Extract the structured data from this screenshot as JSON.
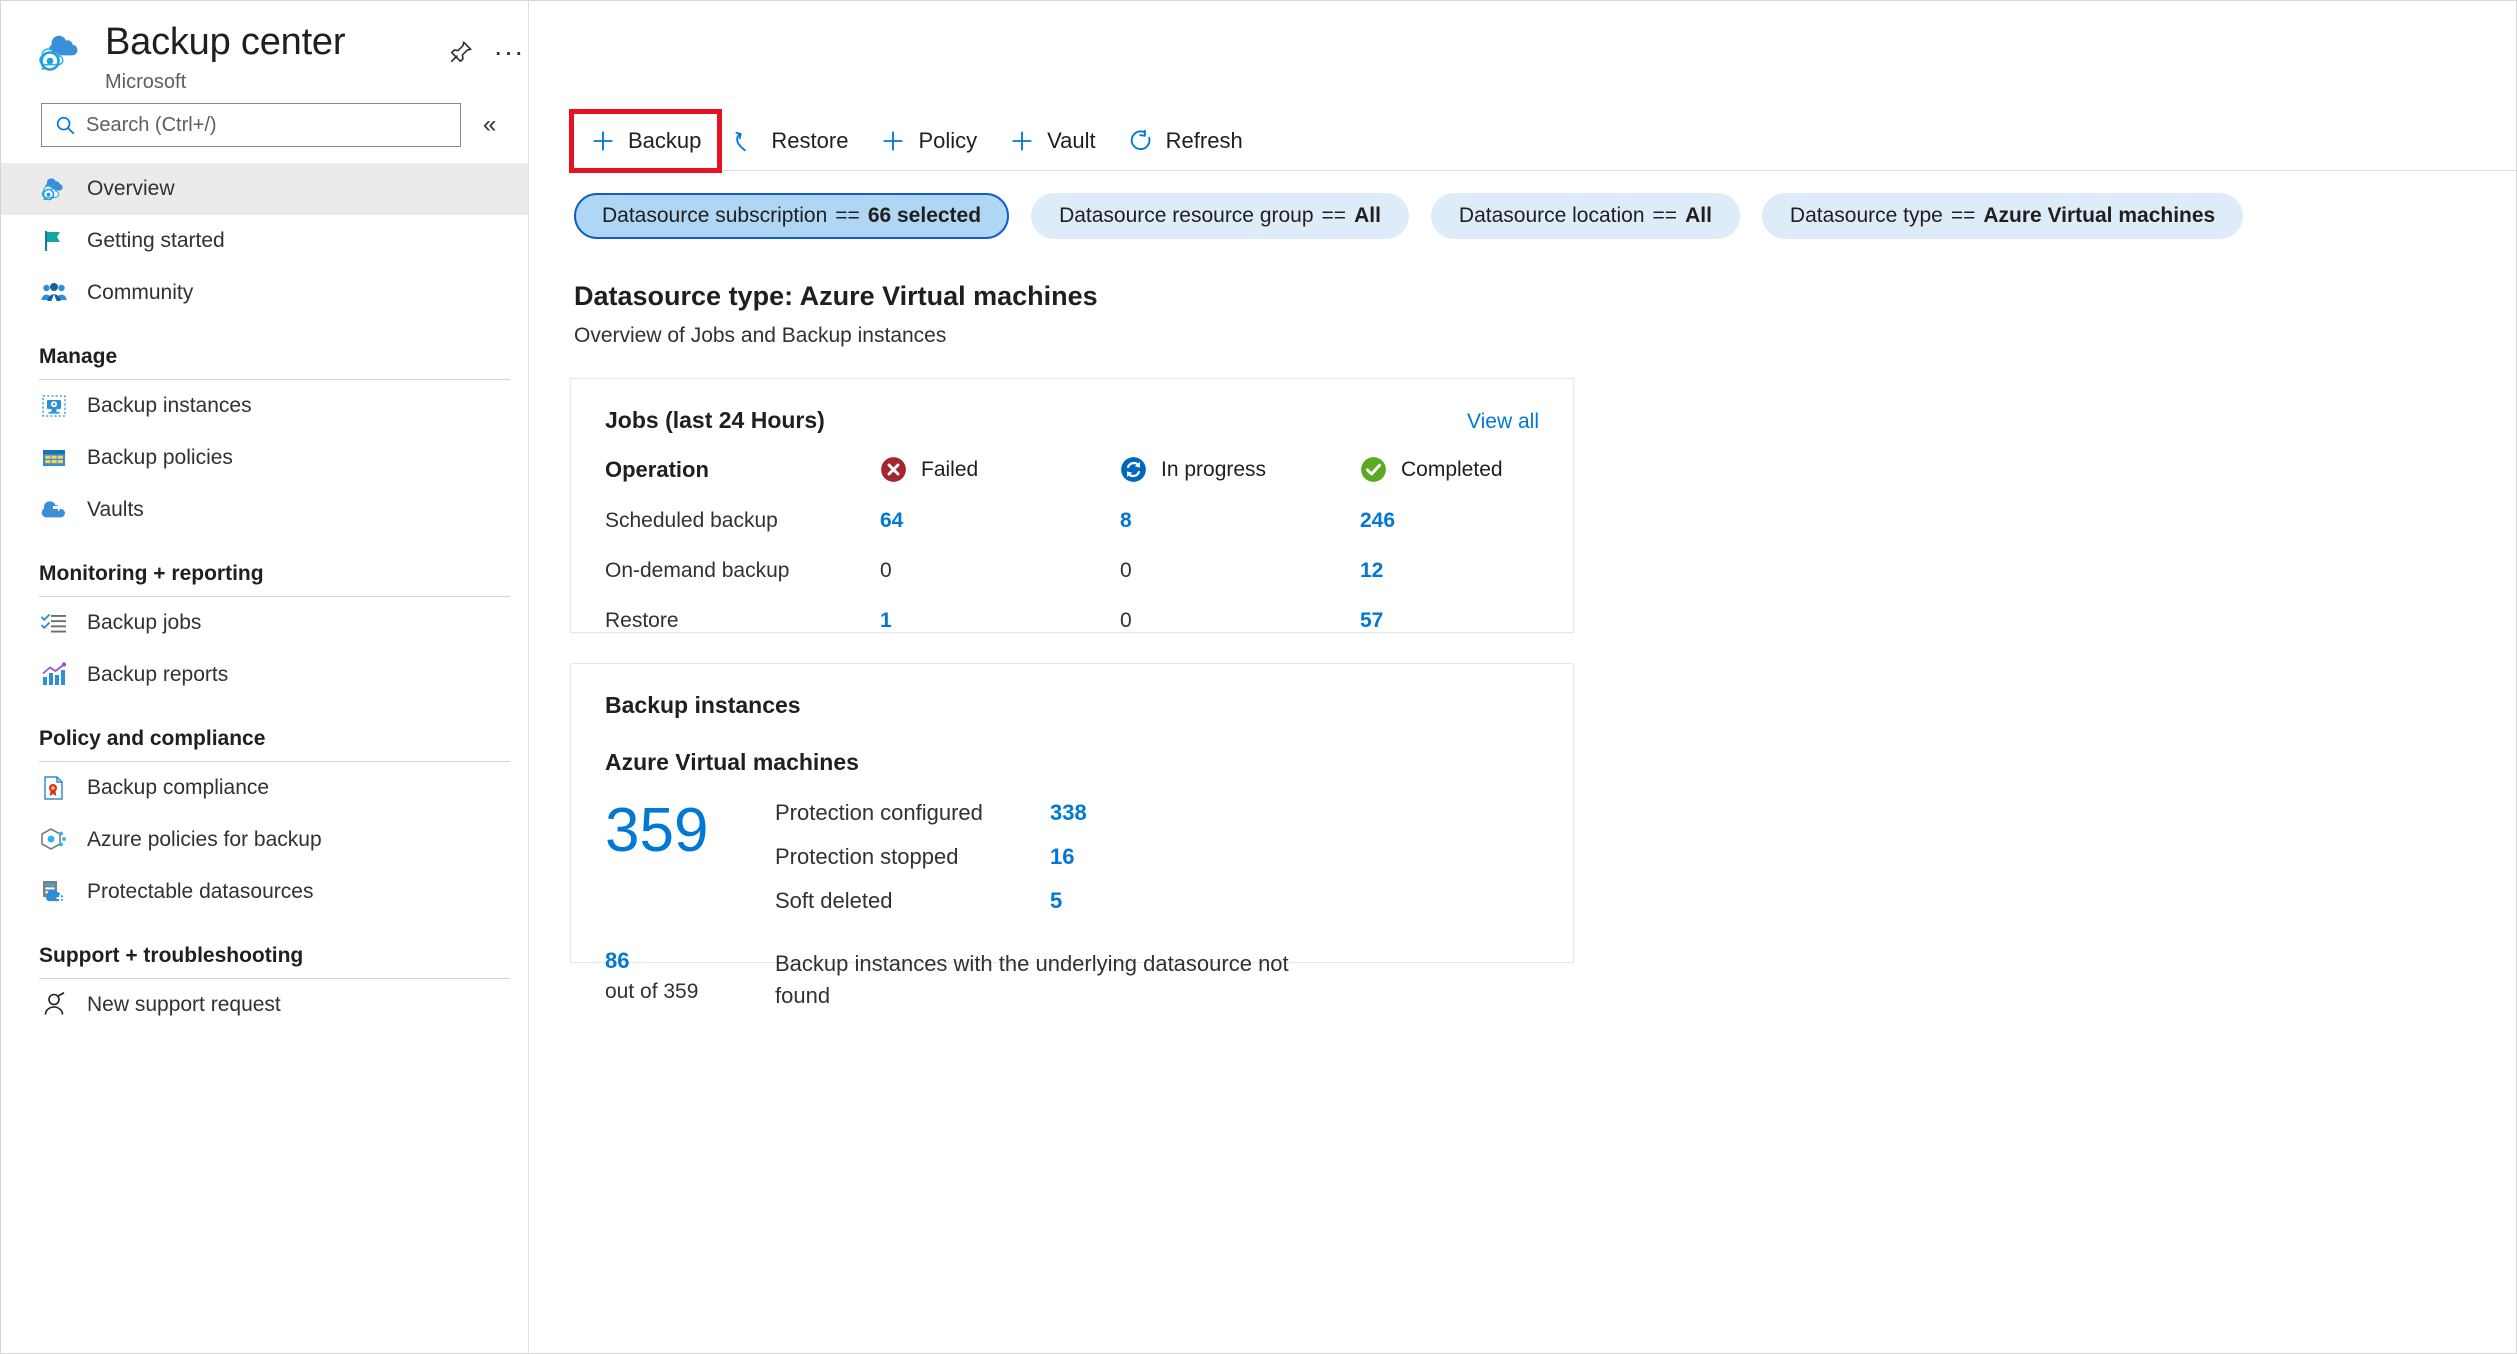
{
  "blade": {
    "title": "Backup center",
    "subtitle": "Microsoft",
    "pin_icon": "pin-icon",
    "more_icon": "ellipsis-icon",
    "more_label": "···"
  },
  "search": {
    "placeholder": "Search (Ctrl+/)",
    "value": "",
    "icon": "search-icon",
    "collapse_icon": "chevron-double-left-icon",
    "collapse_label": "«"
  },
  "sidebar": {
    "top_items": [
      {
        "label": "Overview",
        "icon": "backup-center-cloud-icon",
        "selected": true
      },
      {
        "label": "Getting started",
        "icon": "flag-icon",
        "selected": false
      },
      {
        "label": "Community",
        "icon": "people-icon",
        "selected": false
      }
    ],
    "groups": [
      {
        "title": "Manage",
        "items": [
          {
            "label": "Backup instances",
            "icon": "backup-instance-icon"
          },
          {
            "label": "Backup policies",
            "icon": "backup-policy-grid-icon"
          },
          {
            "label": "Vaults",
            "icon": "vault-cloud-icon"
          }
        ]
      },
      {
        "title": "Monitoring + reporting",
        "items": [
          {
            "label": "Backup jobs",
            "icon": "checklist-icon"
          },
          {
            "label": "Backup reports",
            "icon": "bar-chart-icon"
          }
        ]
      },
      {
        "title": "Policy and compliance",
        "items": [
          {
            "label": "Backup compliance",
            "icon": "compliance-document-icon"
          },
          {
            "label": "Azure policies for backup",
            "icon": "azure-policy-hexagon-icon"
          },
          {
            "label": "Protectable datasources",
            "icon": "protectable-datasource-icon"
          }
        ]
      },
      {
        "title": "Support + troubleshooting",
        "items": [
          {
            "label": "New support request",
            "icon": "support-person-icon"
          }
        ]
      }
    ]
  },
  "toolbar": {
    "commands": [
      {
        "label": "Backup",
        "icon": "plus-icon",
        "highlighted": true
      },
      {
        "label": "Restore",
        "icon": "restore-undo-icon",
        "highlighted": false
      },
      {
        "label": "Policy",
        "icon": "plus-icon",
        "highlighted": false
      },
      {
        "label": "Vault",
        "icon": "plus-icon",
        "highlighted": false
      },
      {
        "label": "Refresh",
        "icon": "refresh-icon",
        "highlighted": false
      }
    ],
    "highlight_color": "#e81123"
  },
  "filters": [
    {
      "name": "Datasource subscription",
      "operator": "==",
      "value": "66 selected",
      "active": true
    },
    {
      "name": "Datasource resource group",
      "operator": "==",
      "value": "All",
      "active": false
    },
    {
      "name": "Datasource location",
      "operator": "==",
      "value": "All",
      "active": false
    },
    {
      "name": "Datasource type",
      "operator": "==",
      "value": "Azure Virtual machines",
      "active": false
    }
  ],
  "page": {
    "title": "Datasource type: Azure Virtual machines",
    "subtitle": "Overview of Jobs and Backup instances"
  },
  "jobs_card": {
    "title": "Jobs (last 24 Hours)",
    "view_all": "View all",
    "operation_header": "Operation",
    "statuses": [
      {
        "label": "Failed",
        "icon": "error-circle-icon",
        "color": "#a4262c"
      },
      {
        "label": "In progress",
        "icon": "in-progress-circle-icon",
        "color": "#0078d4"
      },
      {
        "label": "Completed",
        "icon": "success-check-circle-icon",
        "color": "#5aaa23"
      }
    ],
    "rows": [
      {
        "operation": "Scheduled backup",
        "failed": "64",
        "in_progress": "8",
        "completed": "246"
      },
      {
        "operation": "On-demand backup",
        "failed": "0",
        "in_progress": "0",
        "completed": "12"
      },
      {
        "operation": "Restore",
        "failed": "1",
        "in_progress": "0",
        "completed": "57"
      }
    ]
  },
  "instances_card": {
    "title": "Backup instances",
    "subtitle": "Azure Virtual machines",
    "total": "359",
    "rows": [
      {
        "label": "Protection configured",
        "value": "338"
      },
      {
        "label": "Protection stopped",
        "value": "16"
      },
      {
        "label": "Soft deleted",
        "value": "5"
      }
    ],
    "footer_value": "86",
    "footer_out_of": "out of 359",
    "footer_text": "Backup instances with the underlying datasource not found"
  },
  "colors": {
    "accent": "#0078d4",
    "selected_nav_bg": "#edebe9",
    "pill_bg": "#deecf9",
    "pill_active_bg": "#afd6f4",
    "pill_active_border": "#0f5ec4"
  }
}
